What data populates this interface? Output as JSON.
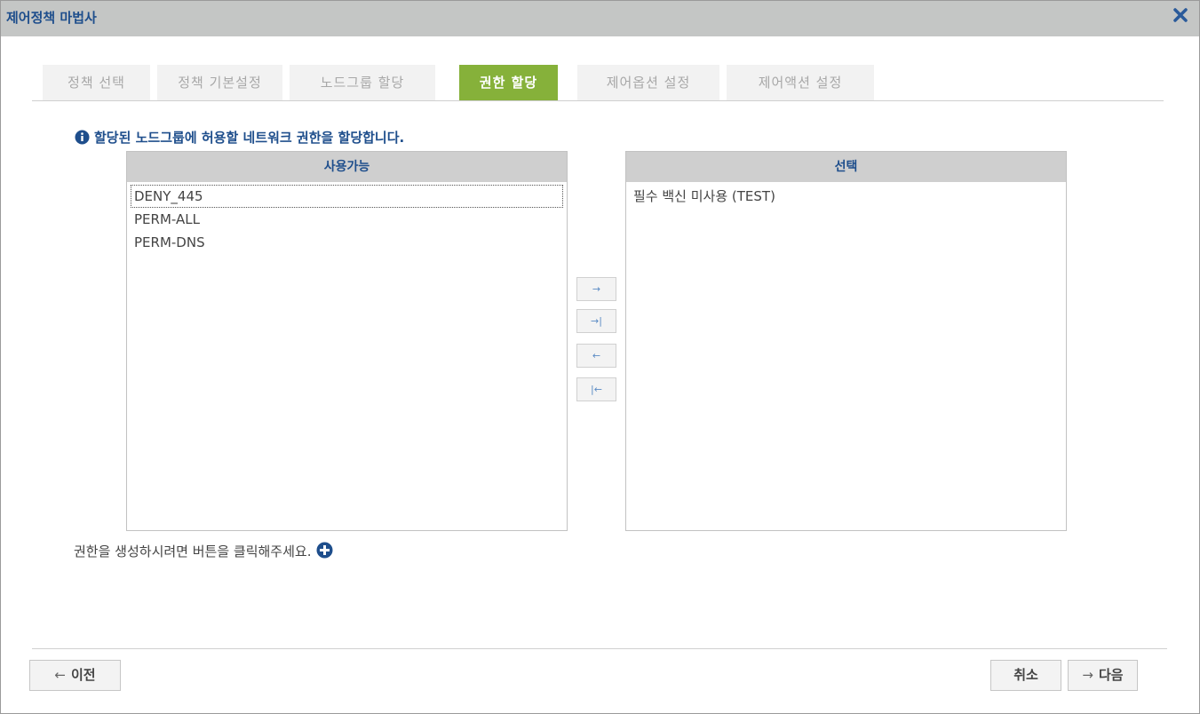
{
  "window": {
    "title": "제어정책 마법사",
    "close_icon": "close-x-icon"
  },
  "tabs": [
    {
      "label": "정책 선택",
      "active": false
    },
    {
      "label": "정책 기본설정",
      "active": false
    },
    {
      "label": "노드그룹 할당",
      "active": false
    },
    {
      "label": "권한 할당",
      "active": true
    },
    {
      "label": "제어옵션 설정",
      "active": false
    },
    {
      "label": "제어액션 설정",
      "active": false
    }
  ],
  "info": {
    "text": "할당된 노드그룹에 허용할 네트워크 권한을 할당합니다.",
    "icon": "info-circle-icon"
  },
  "available": {
    "header": "사용가능",
    "items": [
      "DENY_445",
      "PERM-ALL",
      "PERM-DNS"
    ]
  },
  "selected": {
    "header": "선택",
    "items": [
      "필수 백신 미사용 (TEST)"
    ]
  },
  "move_buttons": {
    "add": "→",
    "add_all": "→|",
    "remove": "←",
    "remove_all": "|←"
  },
  "create": {
    "text": "권한을 생성하시려면 버튼을 클릭해주세요.",
    "icon": "plus-circle-icon"
  },
  "footer": {
    "prev_arrow": "←",
    "prev_label": "이전",
    "cancel_label": "취소",
    "next_arrow": "→",
    "next_label": "다음"
  },
  "colors": {
    "accent": "#86b13a",
    "title_blue": "#1e4e8c",
    "titlebar_bg": "#c4c6c5"
  }
}
